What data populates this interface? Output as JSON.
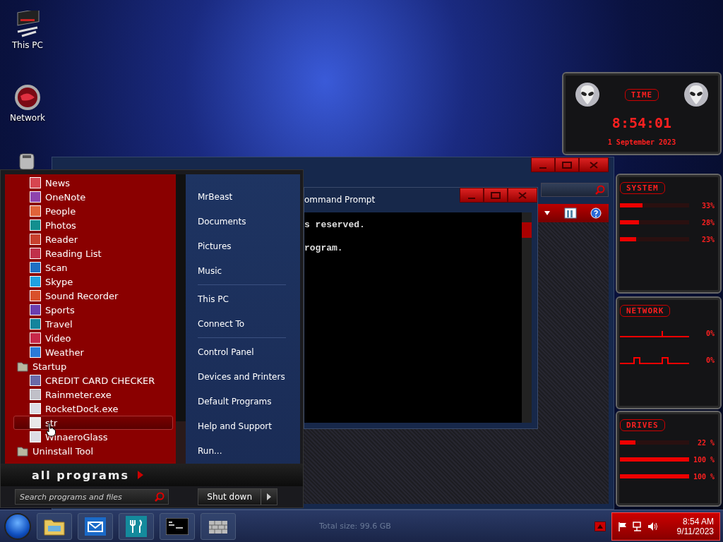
{
  "desktop_icons": [
    {
      "label": "This PC"
    },
    {
      "label": "Network"
    }
  ],
  "cmd_window": {
    "title": "ommand Prompt",
    "lines": [
      {
        "text": "s reserved."
      },
      {
        "text": "rogram."
      }
    ]
  },
  "start_menu": {
    "programs": [
      {
        "label": "News",
        "kind": "app",
        "color": "#d64550",
        "selected": false
      },
      {
        "label": "OneNote",
        "kind": "app",
        "color": "#8e44ad",
        "selected": false
      },
      {
        "label": "People",
        "kind": "app",
        "color": "#e0633a",
        "selected": false
      },
      {
        "label": "Photos",
        "kind": "app",
        "color": "#138f8f",
        "selected": false
      },
      {
        "label": "Reader",
        "kind": "app",
        "color": "#c8402e",
        "selected": false
      },
      {
        "label": "Reading List",
        "kind": "app",
        "color": "#c0304a",
        "selected": false
      },
      {
        "label": "Scan",
        "kind": "app",
        "color": "#1e6fc4",
        "selected": false
      },
      {
        "label": "Skype",
        "kind": "app",
        "color": "#1fa0e0",
        "selected": false
      },
      {
        "label": "Sound Recorder",
        "kind": "app",
        "color": "#d9502a",
        "selected": false
      },
      {
        "label": "Sports",
        "kind": "app",
        "color": "#6a3fb0",
        "selected": false
      },
      {
        "label": "Travel",
        "kind": "app",
        "color": "#14849c",
        "selected": false
      },
      {
        "label": "Video",
        "kind": "app",
        "color": "#c8284a",
        "selected": false
      },
      {
        "label": "Weather",
        "kind": "app",
        "color": "#2a7ad8",
        "selected": false
      },
      {
        "label": "Startup",
        "kind": "folder",
        "selected": false,
        "children": [
          {
            "label": "CREDIT CARD CHECKER",
            "kind": "app",
            "color": "#6a6aa8",
            "selected": false
          },
          {
            "label": "Rainmeter.exe",
            "kind": "app",
            "color": "#c0c0c8",
            "selected": false
          },
          {
            "label": "RocketDock.exe",
            "kind": "app",
            "color": "#dcdce4",
            "selected": false
          },
          {
            "label": "str",
            "kind": "app",
            "color": "#e8e8e8",
            "selected": true
          },
          {
            "label": "WinaeroGlass",
            "kind": "app",
            "color": "#dcdce4",
            "selected": false
          }
        ]
      },
      {
        "label": "Uninstall Tool",
        "kind": "folder",
        "selected": false
      }
    ],
    "links": [
      [
        {
          "label": "MrBeast"
        },
        {
          "label": "Documents"
        },
        {
          "label": "Pictures"
        },
        {
          "label": "Music"
        }
      ],
      [
        {
          "label": "This PC"
        },
        {
          "label": "Connect To"
        }
      ],
      [
        {
          "label": "Control Panel"
        },
        {
          "label": "Devices and Printers"
        },
        {
          "label": "Default Programs"
        },
        {
          "label": "Help and Support"
        },
        {
          "label": "Run..."
        }
      ]
    ],
    "all_programs": "all programs",
    "search": {
      "placeholder": "Search programs and files"
    },
    "shutdown": "Shut down"
  },
  "gadgets": {
    "time": {
      "title": "TIME",
      "clock": "8:54:01",
      "date": "1 September 2023"
    },
    "system": {
      "title": "SYSTEM",
      "meters": [
        {
          "level": 0.33,
          "reading": "33%"
        },
        {
          "level": 0.28,
          "reading": "28%"
        },
        {
          "level": 0.23,
          "reading": "23%"
        }
      ]
    },
    "network": {
      "title": "NETWORK",
      "readings": [
        {
          "reading": "0%"
        },
        {
          "reading": "0%"
        }
      ]
    },
    "drives": {
      "title": "DRIVES",
      "meters": [
        {
          "level": 0.22,
          "reading": "22 %"
        },
        {
          "level": 1,
          "reading": "100 %"
        },
        {
          "level": 1,
          "reading": "100 %"
        }
      ]
    }
  },
  "taskbar": {
    "status_text": "Total size: 99.6 GB",
    "clock": "8:54 AM",
    "date": "9/11/2023"
  }
}
